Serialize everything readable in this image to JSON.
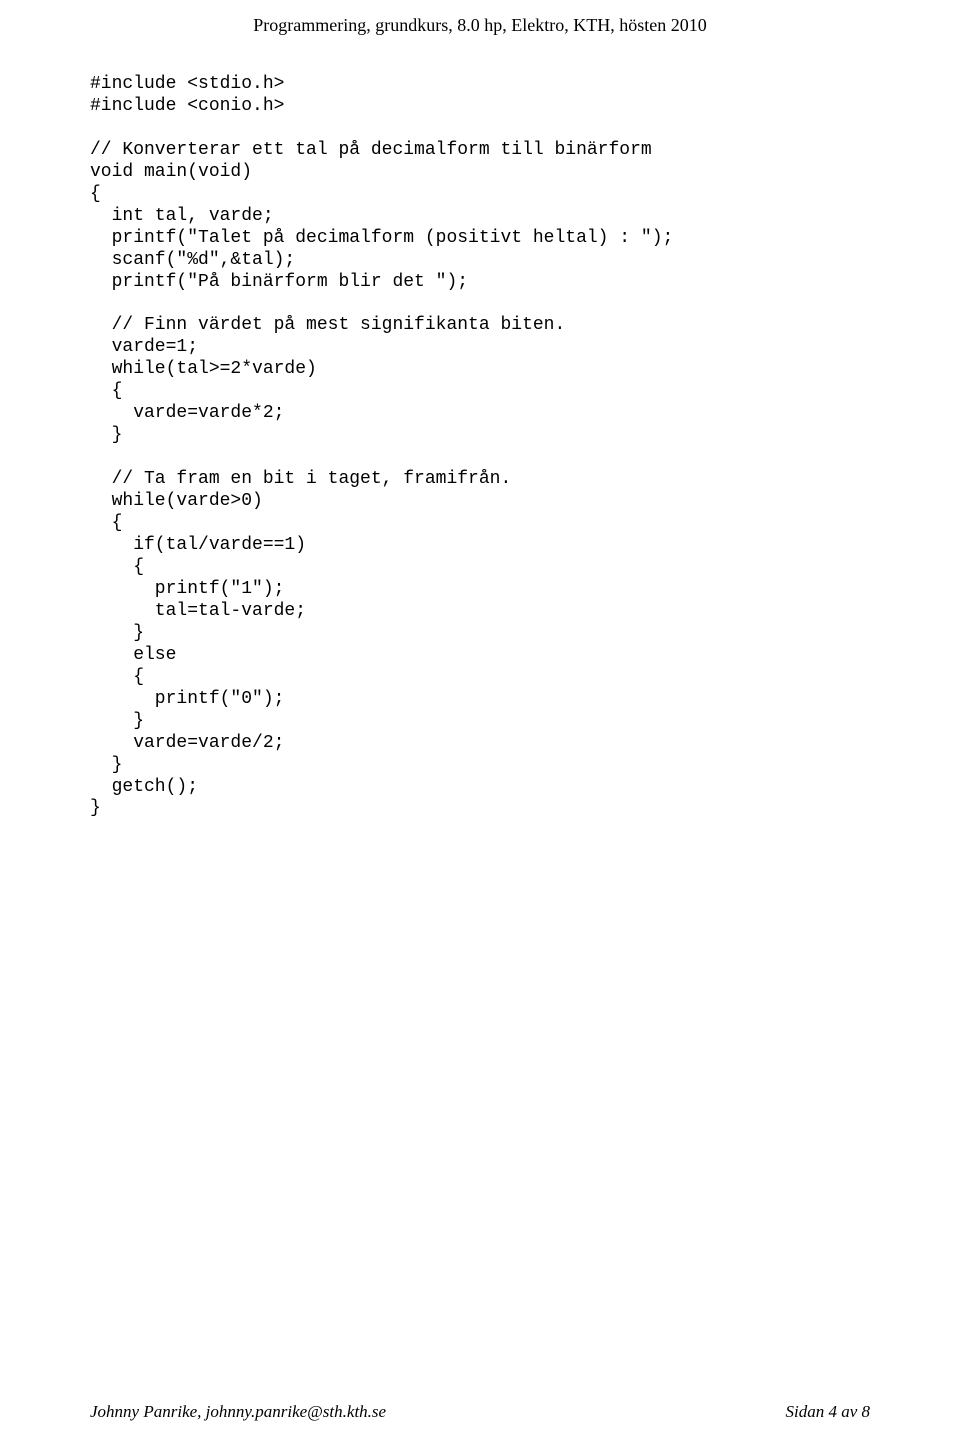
{
  "header": {
    "text": "Programmering, grundkurs, 8.0 hp, Elektro, KTH, hösten 2010"
  },
  "code": {
    "l01": "#include <stdio.h>",
    "l02": "#include <conio.h>",
    "l03": "",
    "l04": "// Konverterar ett tal på decimalform till binärform",
    "l05": "void main(void)",
    "l06": "{",
    "l07": "  int tal, varde;",
    "l08": "  printf(\"Talet på decimalform (positivt heltal) : \");",
    "l09": "  scanf(\"%d\",&tal);",
    "l10": "  printf(\"På binärform blir det \");",
    "l11": "",
    "l12": "  // Finn värdet på mest signifikanta biten.",
    "l13": "  varde=1;",
    "l14": "  while(tal>=2*varde)",
    "l15": "  {",
    "l16": "    varde=varde*2;",
    "l17": "  }",
    "l18": "",
    "l19": "  // Ta fram en bit i taget, framifrån.",
    "l20": "  while(varde>0)",
    "l21": "  {",
    "l22": "    if(tal/varde==1)",
    "l23": "    {",
    "l24": "      printf(\"1\");",
    "l25": "      tal=tal-varde;",
    "l26": "    }",
    "l27": "    else",
    "l28": "    {",
    "l29": "      printf(\"0\");",
    "l30": "    }",
    "l31": "    varde=varde/2;",
    "l32": "  }",
    "l33": "  getch();",
    "l34": "}"
  },
  "footer": {
    "left": "Johnny Panrike, johnny.panrike@sth.kth.se",
    "right": "Sidan 4 av 8"
  }
}
